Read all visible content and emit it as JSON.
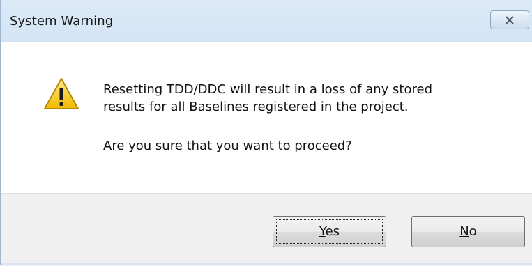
{
  "window": {
    "title": "System Warning",
    "close_icon": "close-icon"
  },
  "message": {
    "icon": "warning-icon",
    "line1": "Resetting TDD/DDC will result in a loss of any stored",
    "line2": "results for all Baselines registered in the project.",
    "line3": "Are you sure that you want to proceed?"
  },
  "buttons": {
    "yes": {
      "mnemonic": "Y",
      "rest": "es"
    },
    "no": {
      "mnemonic": "N",
      "rest": "o"
    }
  },
  "colors": {
    "warning_fill": "#f5c518",
    "titlebar": "#d3e4f5"
  }
}
